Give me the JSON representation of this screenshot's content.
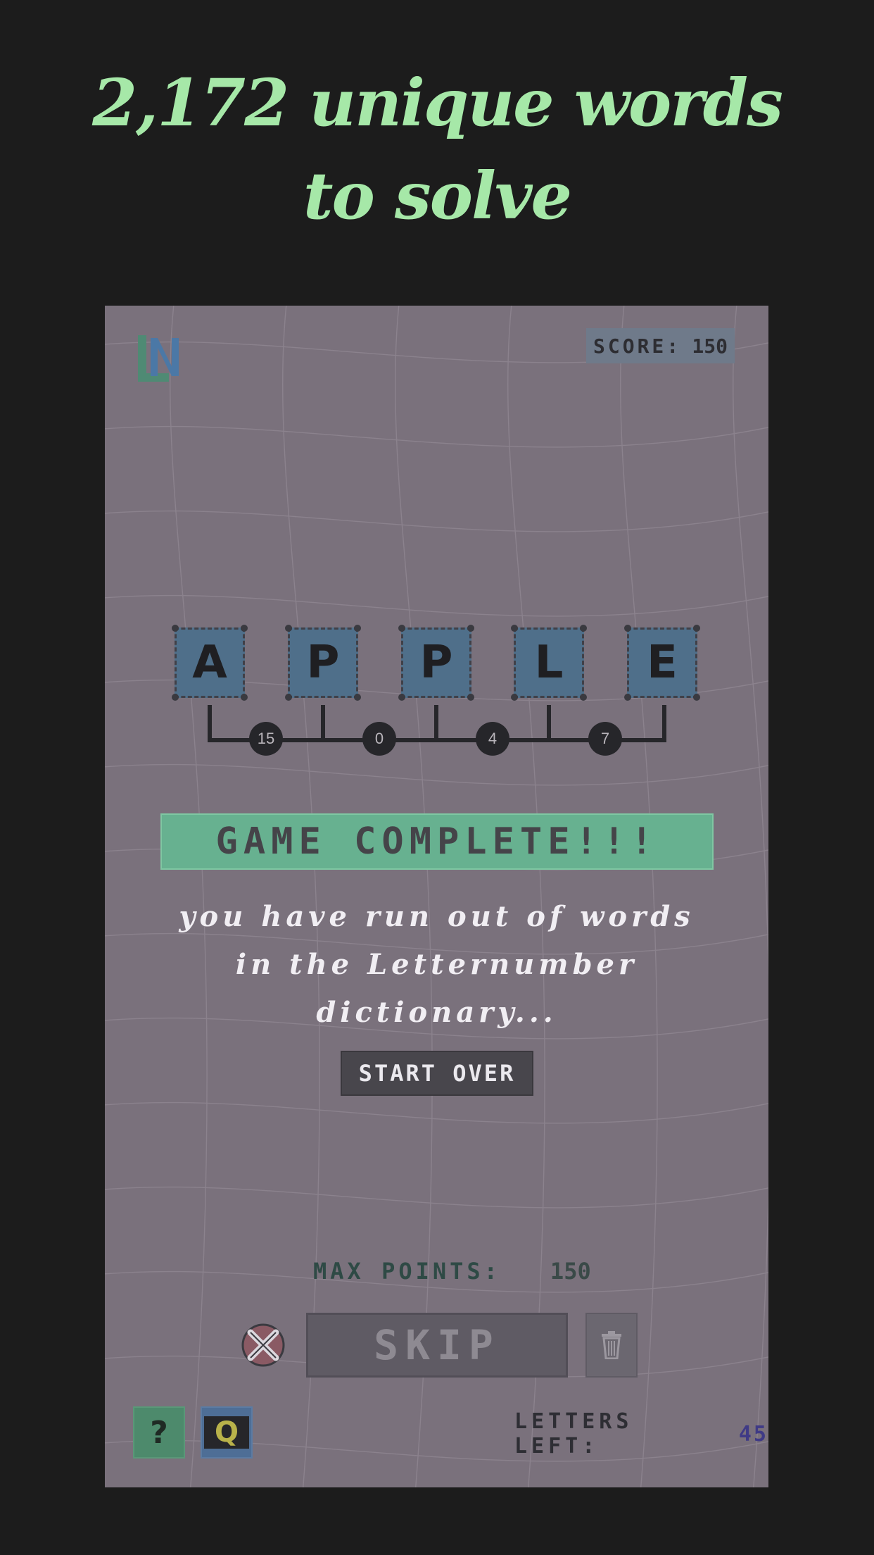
{
  "headline": {
    "line1": "2,172 unique words",
    "line2": "to solve"
  },
  "game": {
    "score_label": "SCORE:",
    "score_value": "150",
    "tiles": [
      "A",
      "P",
      "P",
      "L",
      "E"
    ],
    "numbers": [
      "15",
      "0",
      "4",
      "7"
    ],
    "banner": "GAME COMPLETE!!!",
    "message": {
      "line1": "you have run out of words",
      "line2": "in the Letternumber",
      "line3": "dictionary..."
    },
    "start_over_label": "START OVER",
    "max_points_label": "MAX POINTS:",
    "max_points_value": "150",
    "skip_label": "SKIP",
    "help_label": "?",
    "q_label": "Q",
    "letters_left_label": "LETTERS LEFT:",
    "letters_left_value": "45",
    "logo_letters": "LN"
  },
  "colors": {
    "headline": "#a6e8a8",
    "background": "#1c1c1c",
    "game_bg": "#7a717c",
    "tile": "#4f6f8a",
    "banner": "#67b190",
    "accent_blue": "#3f3a86"
  },
  "icons": {
    "logo": "ln-logo-icon",
    "x_button": "x-circle-icon",
    "trash": "trash-icon",
    "help": "question-icon",
    "q": "q-hint-icon"
  }
}
